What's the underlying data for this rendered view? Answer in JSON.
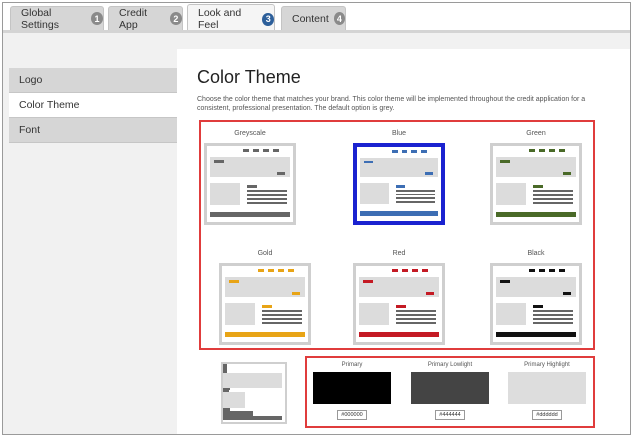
{
  "tabs": [
    {
      "label": "Global Settings",
      "num": "1"
    },
    {
      "label": "Credit App",
      "num": "2"
    },
    {
      "label": "Look and Feel",
      "num": "3"
    },
    {
      "label": "Content",
      "num": "4"
    }
  ],
  "sidebar": {
    "items": [
      {
        "label": "Logo"
      },
      {
        "label": "Color Theme"
      },
      {
        "label": "Font"
      }
    ]
  },
  "main": {
    "title": "Color Theme",
    "description": "Choose the color theme that matches your brand. This color theme will be implemented throughout the credit application for a consistent, professional presentation. The default option is grey."
  },
  "themes": [
    {
      "label": "Greyscale",
      "accent": "#666666",
      "selected": false
    },
    {
      "label": "Blue",
      "accent": "#3d6eb4",
      "selected": true
    },
    {
      "label": "Green",
      "accent": "#4a6a28",
      "selected": false
    },
    {
      "label": "Gold",
      "accent": "#e8a416",
      "selected": false
    },
    {
      "label": "Red",
      "accent": "#c41a24",
      "selected": false
    },
    {
      "label": "Black",
      "accent": "#111111",
      "selected": false
    }
  ],
  "custom": {
    "swatches": [
      {
        "label": "Primary",
        "color": "#000000",
        "value": "#000000"
      },
      {
        "label": "Primary Lowlight",
        "color": "#444444",
        "value": "#444444"
      },
      {
        "label": "Primary Highlight",
        "color": "#dddddd",
        "value": "#dddddd"
      }
    ]
  },
  "colors": {
    "selection_border": "#1a22d0",
    "highlight_box": "#e03c3c",
    "active_tab_badge": "#2d5f9a"
  }
}
